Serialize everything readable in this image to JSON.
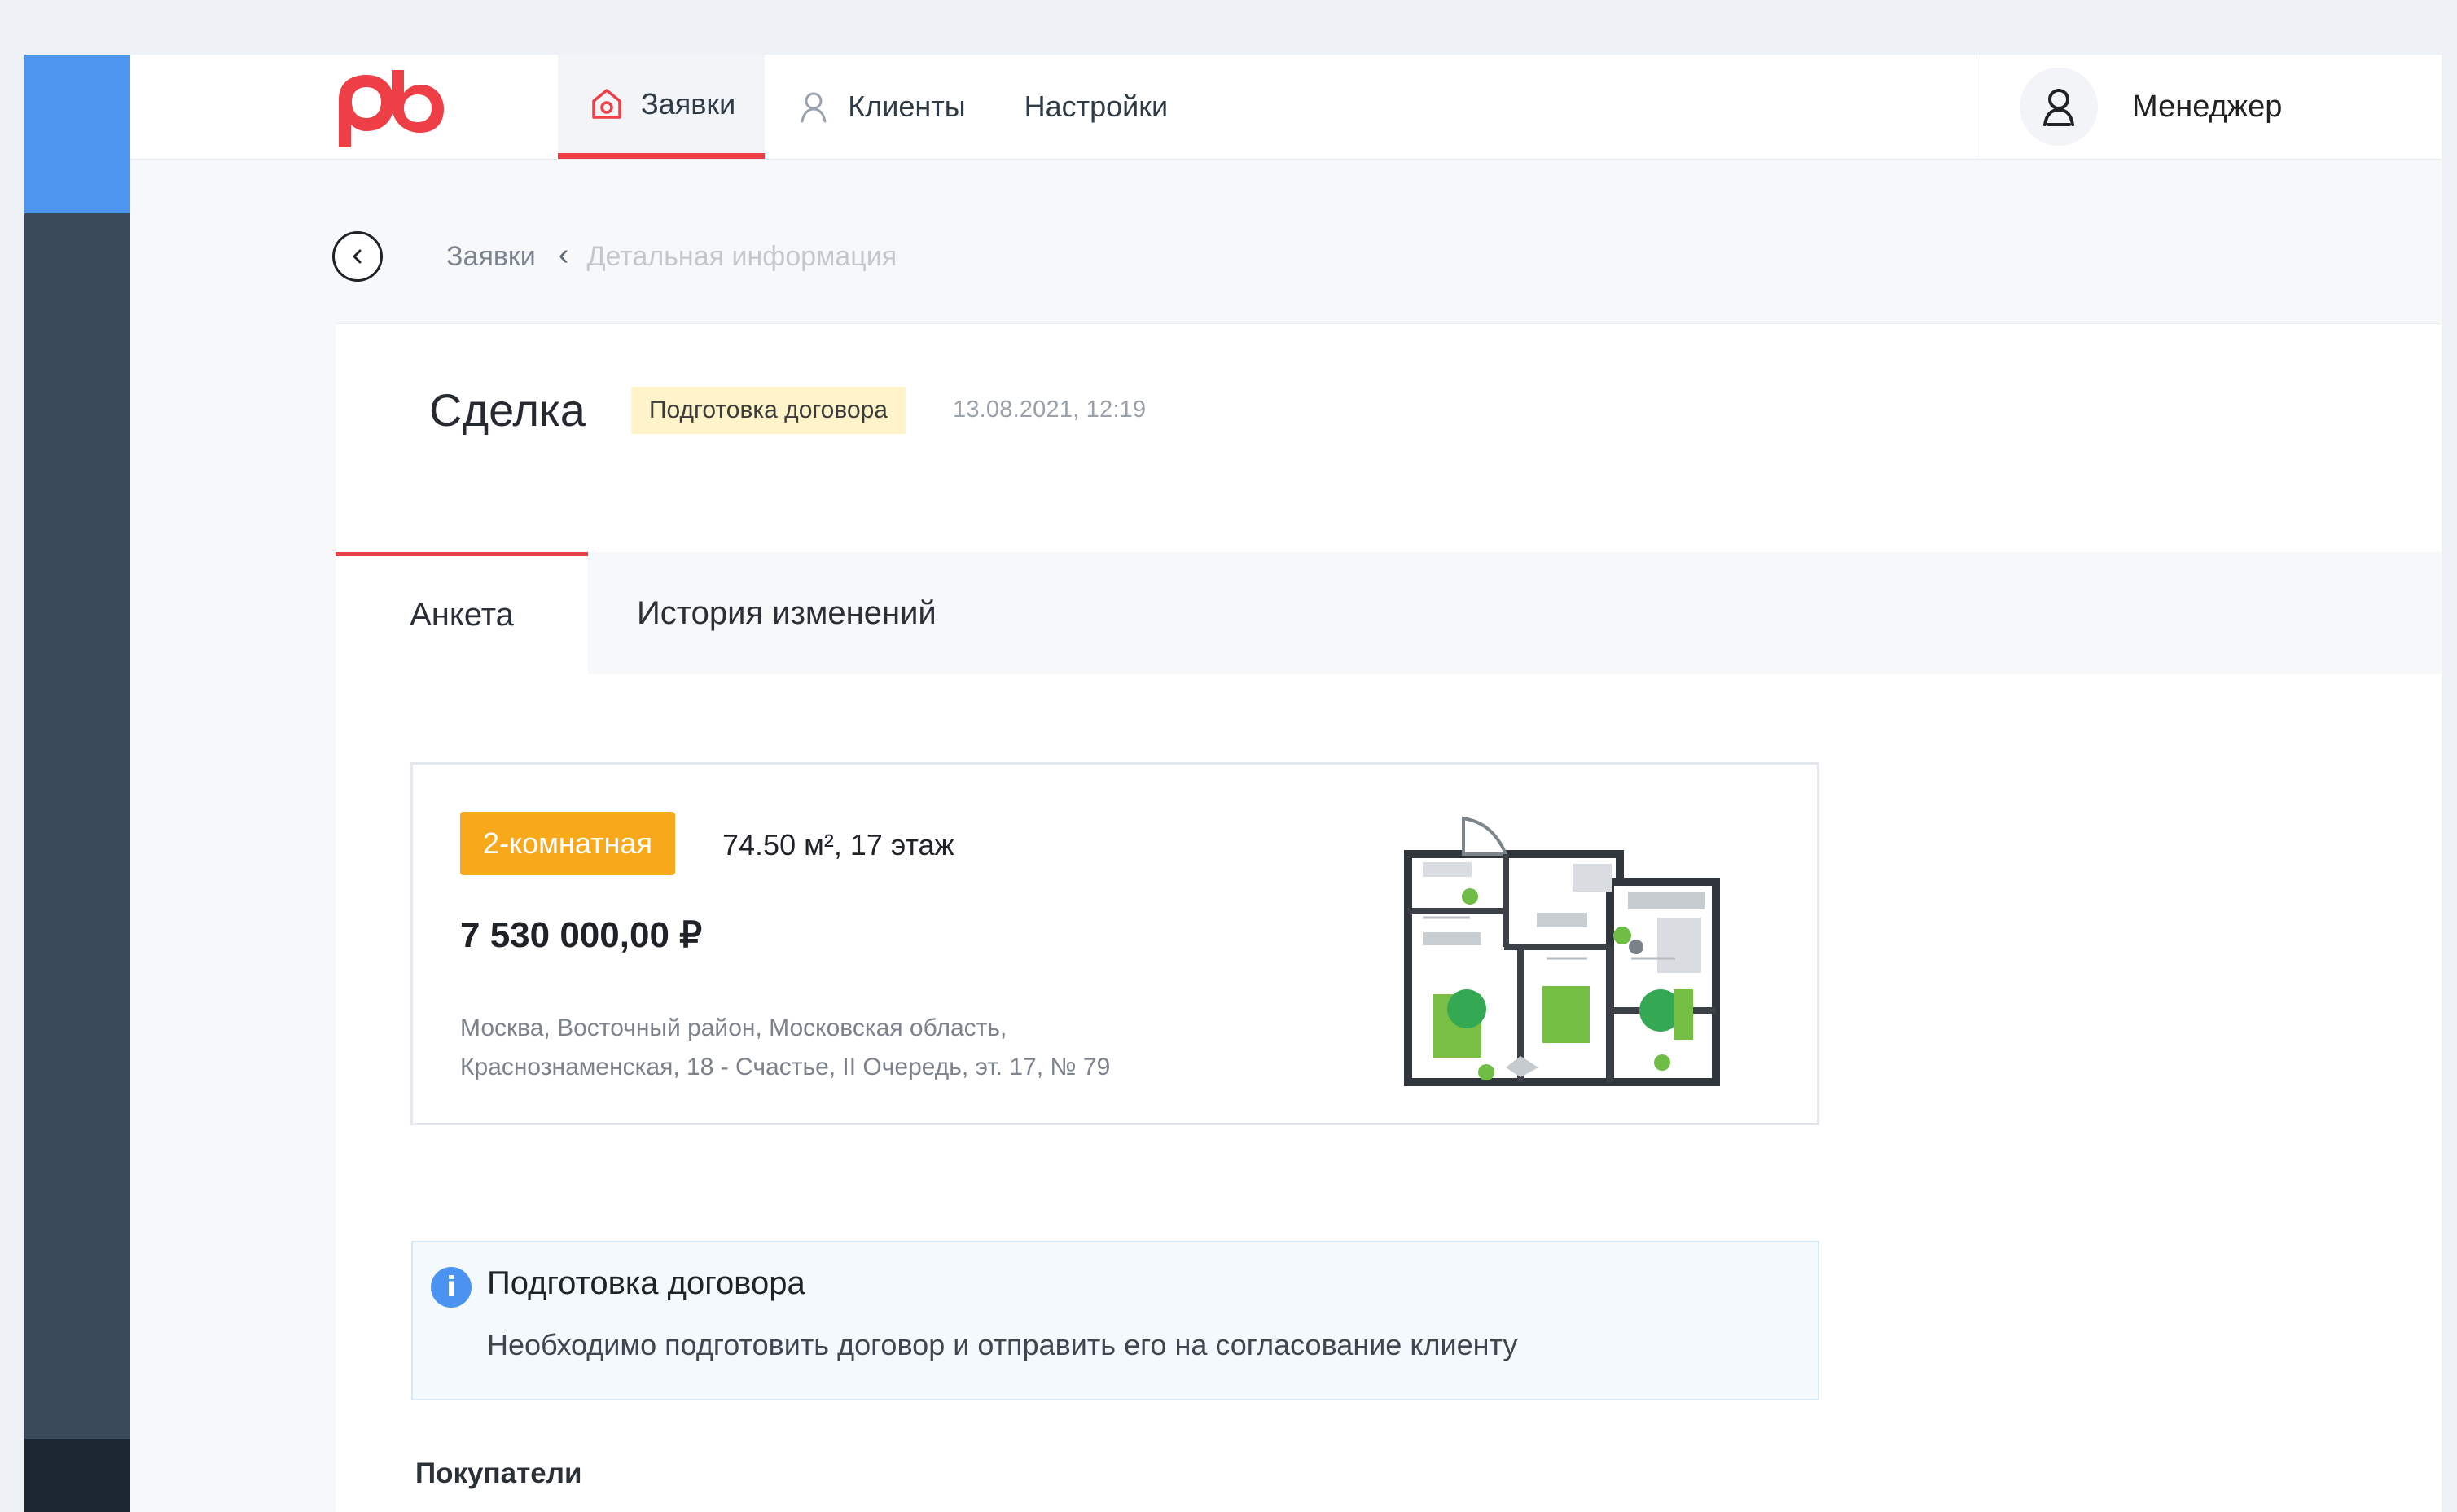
{
  "app": {
    "logo_text": "pb"
  },
  "colors": {
    "brand": "#ef3f46",
    "rail": "#3b4a5b",
    "rail_top": "#4d95ef",
    "room_badge": "#f7a81b",
    "info_icon": "#4a93f0",
    "status_badge_bg": "#fff4c9"
  },
  "nav": {
    "items": [
      {
        "label": "Заявки",
        "icon": "home-icon",
        "active": true
      },
      {
        "label": "Клиенты",
        "icon": "user-icon",
        "active": false
      },
      {
        "label": "Настройки",
        "icon": "",
        "active": false
      }
    ]
  },
  "profile": {
    "name": "Менеджер",
    "icon": "user-avatar-icon"
  },
  "breadcrumb": {
    "back_icon": "chevron-left-circle-icon",
    "items": [
      "Заявки",
      "Детальная информация"
    ],
    "separator": "‹"
  },
  "deal": {
    "title": "Сделка",
    "status": "Подготовка договора",
    "datetime": "13.08.2021, 12:19"
  },
  "tabs": [
    {
      "label": "Анкета",
      "active": true
    },
    {
      "label": "История изменений",
      "active": false
    }
  ],
  "object": {
    "room_type": "2-комнатная",
    "specs": "74.50 м², 17 этаж",
    "price": "7 530 000,00 ₽",
    "address_line_1": "Москва, Восточный район, Московская область,",
    "address_line_2": "Краснознаменская, 18 - Счастье, II Очередь, эт. 17, № 79",
    "floorplan_icon": "floorplan-image"
  },
  "notice": {
    "icon": "info-icon",
    "title": "Подготовка договора",
    "text": "Необходимо подготовить договор и отправить его на согласование клиенту"
  },
  "buyers": {
    "title": "Покупатели"
  }
}
